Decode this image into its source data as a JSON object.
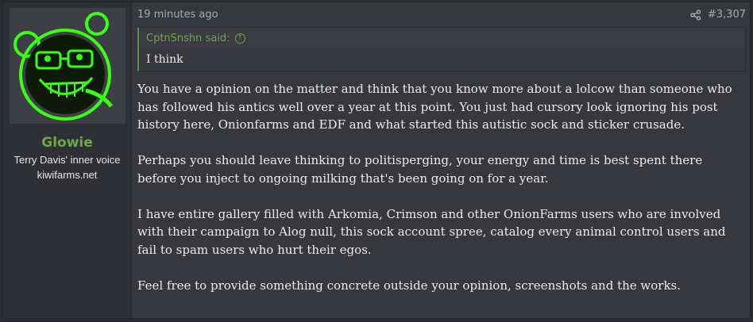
{
  "user": {
    "name": "Glowie",
    "title": "Terry Davis' inner voice",
    "site": "kiwifarms.net",
    "avatar_icon": "green-glowing-face-avatar"
  },
  "post": {
    "time": "19 minutes ago",
    "number": "#3,307",
    "share_icon": "share-icon"
  },
  "quote": {
    "attribution": "CptnSnshn said:",
    "text": "I think"
  },
  "body": {
    "paragraphs": [
      "You have a opinion on the matter and think that you know more about a lolcow than someone who has followed his antics well over a year at this point. You just had cursory look ignoring his post history here, Onionfarms and EDF and what started this autistic sock and sticker crusade.",
      "Perhaps you should leave thinking to politisperging, your energy and time is best spent there before you inject to ongoing milking that's been going on for a year.",
      "I have entire gallery filled with Arkomia, Crimson and other OnionFarms users who are involved with their campaign to Alog null, this sock account spree, catalog every animal control users and fail to spam users who hurt their egos.",
      "Feel free to provide something concrete outside your opinion, screenshots and the works."
    ]
  },
  "colors": {
    "accent_green": "#6ca84a",
    "avatar_glow": "#39ff14"
  }
}
